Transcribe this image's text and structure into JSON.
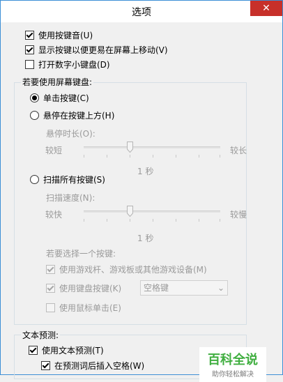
{
  "window": {
    "title": "选项",
    "close_glyph": "✕"
  },
  "top_options": [
    {
      "label": "使用按键音(U)",
      "checked": true
    },
    {
      "label": "显示按键以便更易在屏幕上移动(V)",
      "checked": true
    },
    {
      "label": "打开数字小键盘(D)",
      "checked": false
    }
  ],
  "screen_kb_group": {
    "title": "若要使用屏幕键盘:",
    "radio_click": "单击按键(C)",
    "radio_hover": "悬停在按键上方(H)",
    "hover_duration_label": "悬停时长(O):",
    "hover_short": "较短",
    "hover_long": "较长",
    "hover_value": "1 秒",
    "radio_scan": "扫描所有按键(S)",
    "scan_speed_label": "扫描速度(N):",
    "scan_fast": "较快",
    "scan_slow": "较慢",
    "scan_value": "1 秒",
    "select_key_label": "若要选择一个按键:",
    "opt_joystick": "使用游戏杆、游戏板或其他游戏设备(M)",
    "opt_keyboard_key": "使用键盘按键(K)",
    "keyboard_key_value": "空格键",
    "opt_mouse_click": "使用鼠标单击(E)"
  },
  "prediction_group": {
    "title": "文本预测:",
    "use_prediction": "使用文本预测(T)",
    "insert_space": "在预测词后插入空格(W)"
  },
  "watermark": {
    "title": "百科全说",
    "subtitle": "助你轻松解决"
  }
}
